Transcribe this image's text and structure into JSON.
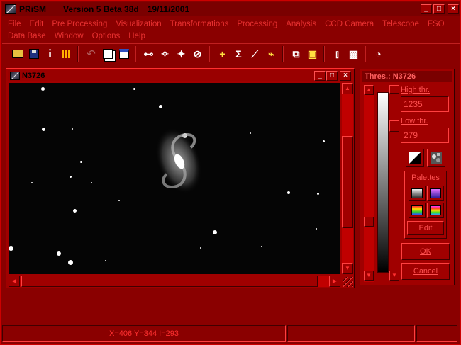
{
  "app": {
    "name": "PRiSM",
    "version": "Version 5 Beta 38d",
    "date": "19/11/2001",
    "window_buttons": {
      "minimize": "_",
      "maximize": "□",
      "close": "×"
    }
  },
  "menu": {
    "row1": [
      "File",
      "Edit",
      "Pre Processing",
      "Visualization",
      "Transformations",
      "Processing",
      "Analysis",
      "CCD Camera",
      "Telescope",
      "FSO"
    ],
    "row2": [
      "Data Base",
      "Window",
      "Options",
      "Help"
    ]
  },
  "toolbar": {
    "icons": [
      "open-icon",
      "save-icon",
      "info-icon",
      "grid-icon",
      "undo-icon",
      "copy-icon",
      "paste-icon",
      "blink-icon",
      "zoom-in-icon",
      "zoom-out-icon",
      "zoom-fit-icon",
      "crosshair-icon",
      "sum-icon",
      "graph-icon",
      "curve-icon",
      "stack-icon",
      "printer-icon",
      "telescope-icon",
      "camera-icon",
      "clock-icon"
    ]
  },
  "image_window": {
    "title": "N3726",
    "buttons": {
      "minimize": "_",
      "maximize": "□",
      "close": "×"
    }
  },
  "threshold": {
    "title": "Thres.: N3726",
    "high_label": "High thr.",
    "high_value": "1235",
    "low_label": "Low thr.",
    "low_value": "279",
    "palettes_label": "Palettes",
    "edit_label": "Edit",
    "ok_label": "OK",
    "cancel_label": "Cancel",
    "palette_colors": [
      "#808080",
      "#7a3cc0",
      "#f0c000",
      "#40c0ff"
    ]
  },
  "status": {
    "cursor": "X=406 Y=344 I=293",
    "panel2": "",
    "panel3": ""
  }
}
